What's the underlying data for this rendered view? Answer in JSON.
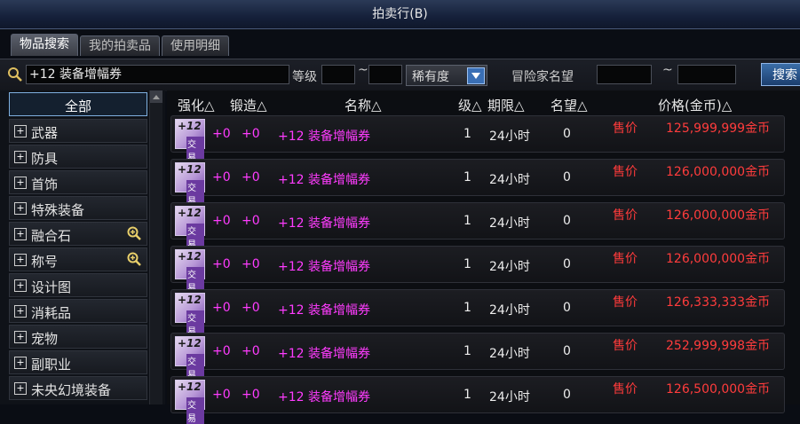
{
  "window": {
    "title": "拍卖行(B)"
  },
  "tabs": [
    {
      "label": "物品搜索"
    },
    {
      "label": "我的拍卖品"
    },
    {
      "label": "使用明细"
    }
  ],
  "search": {
    "value": "+12 装备增幅券",
    "level_label": "等级",
    "tilde": "~",
    "rarity_label": "稀有度",
    "fame_label": "冒险家名望",
    "button_label": "搜索"
  },
  "sidebar": {
    "items": [
      {
        "label": "全部"
      },
      {
        "label": "武器"
      },
      {
        "label": "防具"
      },
      {
        "label": "首饰"
      },
      {
        "label": "特殊装备"
      },
      {
        "label": "融合石"
      },
      {
        "label": "称号"
      },
      {
        "label": "设计图"
      },
      {
        "label": "消耗品"
      },
      {
        "label": "宠物"
      },
      {
        "label": "副职业"
      },
      {
        "label": "未央幻境装备"
      }
    ]
  },
  "table": {
    "headers": {
      "strengthen": "强化△",
      "forge": "锻造△",
      "name": "名称△",
      "level": "级△",
      "period": "期限△",
      "fame": "名望△",
      "price": "价格(金币)△"
    },
    "icon_text": {
      "plus": "+12",
      "trade": "交易"
    },
    "rows": [
      {
        "strengthen": "+0",
        "forge": "+0",
        "name": "+12 装备增幅券",
        "level": "1",
        "period": "24小时",
        "fame": "0",
        "sale": "售价",
        "price": "125,999,999金币"
      },
      {
        "strengthen": "+0",
        "forge": "+0",
        "name": "+12 装备增幅券",
        "level": "1",
        "period": "24小时",
        "fame": "0",
        "sale": "售价",
        "price": "126,000,000金币"
      },
      {
        "strengthen": "+0",
        "forge": "+0",
        "name": "+12 装备增幅券",
        "level": "1",
        "period": "24小时",
        "fame": "0",
        "sale": "售价",
        "price": "126,000,000金币"
      },
      {
        "strengthen": "+0",
        "forge": "+0",
        "name": "+12 装备增幅券",
        "level": "1",
        "period": "24小时",
        "fame": "0",
        "sale": "售价",
        "price": "126,000,000金币"
      },
      {
        "strengthen": "+0",
        "forge": "+0",
        "name": "+12 装备增幅券",
        "level": "1",
        "period": "24小时",
        "fame": "0",
        "sale": "售价",
        "price": "126,333,333金币"
      },
      {
        "strengthen": "+0",
        "forge": "+0",
        "name": "+12 装备增幅券",
        "level": "1",
        "period": "24小时",
        "fame": "0",
        "sale": "售价",
        "price": "252,999,998金币"
      },
      {
        "strengthen": "+0",
        "forge": "+0",
        "name": "+12 装备增幅券",
        "level": "1",
        "period": "24小时",
        "fame": "0",
        "sale": "售价",
        "price": "126,500,000金币"
      }
    ]
  }
}
